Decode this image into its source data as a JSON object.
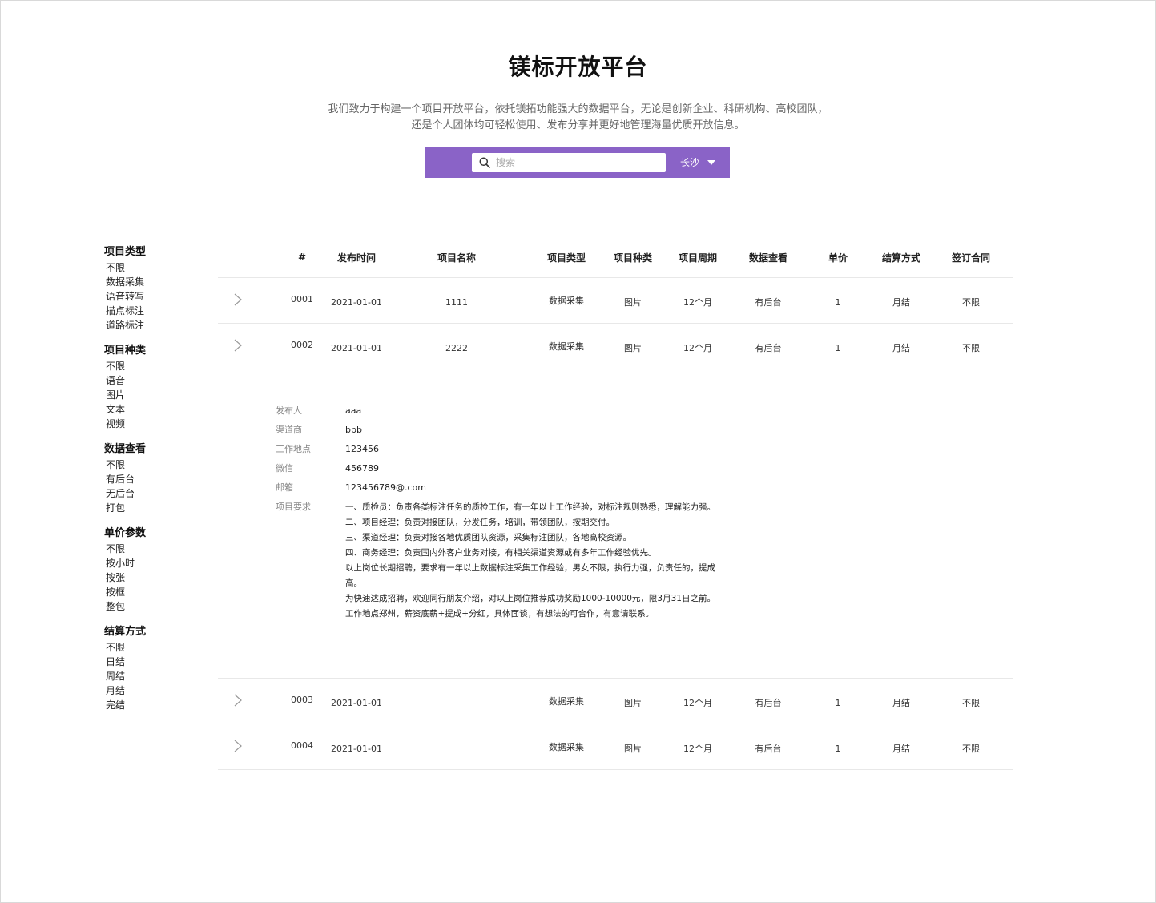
{
  "header": {
    "title": "镁标开放平台",
    "subtitle_line1": "我们致力于构建一个项目开放平台，依托镁拓功能强大的数据平台，无论是创新企业、科研机构、高校团队，",
    "subtitle_line2": "还是个人团体均可轻松使用、发布分享并更好地管理海量优质开放信息。"
  },
  "search": {
    "placeholder": "搜索",
    "city": "长沙",
    "accent": "#8a63c7"
  },
  "filters": [
    {
      "title": "项目类型",
      "options": [
        "不限",
        "数据采集",
        "语音转写",
        "描点标注",
        "道路标注"
      ]
    },
    {
      "title": "项目种类",
      "options": [
        "不限",
        "语音",
        "图片",
        "文本",
        "视频"
      ]
    },
    {
      "title": "数据查看",
      "options": [
        "不限",
        "有后台",
        "无后台",
        "打包"
      ]
    },
    {
      "title": "单价参数",
      "options": [
        "不限",
        "按小时",
        "按张",
        "按框",
        "整包"
      ]
    },
    {
      "title": "结算方式",
      "options": [
        "不限",
        "日结",
        "周结",
        "月结",
        "完结"
      ]
    }
  ],
  "table": {
    "headers": {
      "num": "#",
      "date": "发布时间",
      "name": "项目名称",
      "type": "项目类型",
      "kind": "项目种类",
      "period": "项目周期",
      "view": "数据查看",
      "price": "单价",
      "settle": "结算方式",
      "contract": "签订合同"
    },
    "rows": [
      {
        "num": "0001",
        "date": "2021-01-01",
        "name": "1111",
        "type": "数据采集",
        "kind": "图片",
        "period": "12个月",
        "view": "有后台",
        "price": "1",
        "settle": "月结",
        "contract": "不限"
      },
      {
        "num": "0002",
        "date": "2021-01-01",
        "name": "2222",
        "type": "数据采集",
        "kind": "图片",
        "period": "12个月",
        "view": "有后台",
        "price": "1",
        "settle": "月结",
        "contract": "不限"
      },
      {
        "num": "0003",
        "date": "2021-01-01",
        "name": "",
        "type": "数据采集",
        "kind": "图片",
        "period": "12个月",
        "view": "有后台",
        "price": "1",
        "settle": "月结",
        "contract": "不限"
      },
      {
        "num": "0004",
        "date": "2021-01-01",
        "name": "",
        "type": "数据采集",
        "kind": "图片",
        "period": "12个月",
        "view": "有后台",
        "price": "1",
        "settle": "月结",
        "contract": "不限"
      }
    ]
  },
  "detail": {
    "publisher_label": "发布人",
    "publisher": "aaa",
    "channel_label": "渠道商",
    "channel": "bbb",
    "location_label": "工作地点",
    "location": "123456",
    "wechat_label": "微信",
    "wechat": "456789",
    "email_label": "邮箱",
    "email": "123456789@.com",
    "requirements_label": "项目要求",
    "requirements": [
      "一、质检员：负责各类标注任务的质检工作，有一年以上工作经验，对标注规则熟悉，理解能力强。",
      "二、项目经理：负责对接团队，分发任务，培训，带领团队，按期交付。",
      "三、渠道经理：负责对接各地优质团队资源，采集标注团队，各地高校资源。",
      "四、商务经理：负责国内外客户业务对接，有相关渠道资源或有多年工作经验优先。",
      "以上岗位长期招聘，要求有一年以上数据标注采集工作经验，男女不限，执行力强，负责任的，提成高。",
      "为快速达成招聘，欢迎同行朋友介绍，对以上岗位推荐成功奖励1000-10000元，限3月31日之前。",
      "工作地点郑州，薪资底薪+提成+分红，具体面谈，有想法的可合作，有意请联系。"
    ]
  }
}
